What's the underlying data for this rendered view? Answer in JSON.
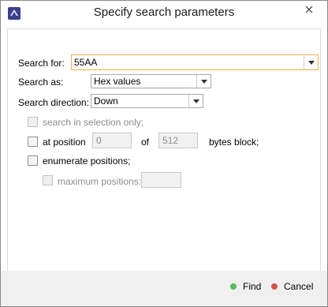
{
  "window": {
    "title": "Specify search parameters"
  },
  "form": {
    "search_for": {
      "label": "Search for:",
      "value": "55AA"
    },
    "search_as": {
      "label": "Search as:",
      "value": "Hex values"
    },
    "search_direction": {
      "label": "Search direction:",
      "value": "Down"
    },
    "selection_only": {
      "label": "search in selection only;",
      "checked": false
    },
    "at_position": {
      "label": "at position",
      "value": "0",
      "of_label": "of",
      "block_value": "512",
      "suffix": "bytes block;",
      "checked": false
    },
    "enumerate": {
      "label": "enumerate positions;",
      "checked": false
    },
    "max_positions": {
      "label": "maximum positions:",
      "value": "",
      "checked": false
    }
  },
  "footer": {
    "find_label": "Find",
    "cancel_label": "Cancel"
  },
  "colors": {
    "find_dot": "#5cb85c",
    "cancel_dot": "#d9534f",
    "focus_border": "#e8b34c"
  },
  "icons": {
    "app": "app-logo-icon",
    "close": "close-icon",
    "dropdown": "chevron-down-icon"
  }
}
